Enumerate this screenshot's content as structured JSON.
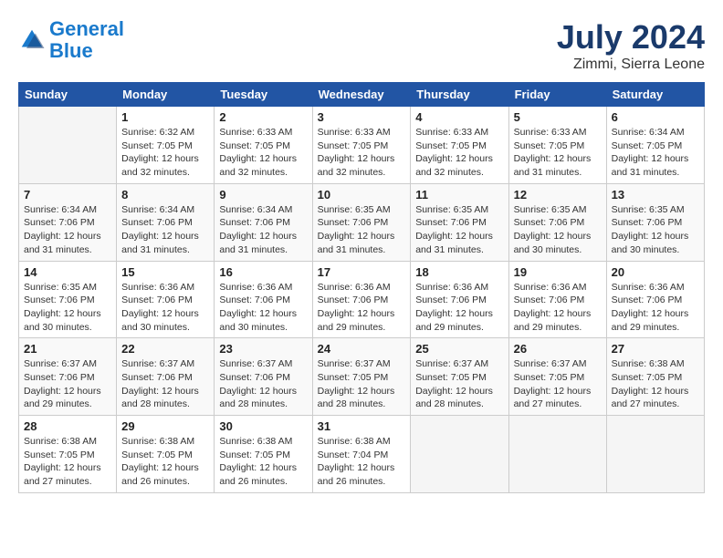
{
  "header": {
    "logo_line1": "General",
    "logo_line2": "Blue",
    "month_title": "July 2024",
    "subtitle": "Zimmi, Sierra Leone"
  },
  "weekdays": [
    "Sunday",
    "Monday",
    "Tuesday",
    "Wednesday",
    "Thursday",
    "Friday",
    "Saturday"
  ],
  "weeks": [
    [
      {
        "day": "",
        "info": ""
      },
      {
        "day": "1",
        "info": "Sunrise: 6:32 AM\nSunset: 7:05 PM\nDaylight: 12 hours\nand 32 minutes."
      },
      {
        "day": "2",
        "info": "Sunrise: 6:33 AM\nSunset: 7:05 PM\nDaylight: 12 hours\nand 32 minutes."
      },
      {
        "day": "3",
        "info": "Sunrise: 6:33 AM\nSunset: 7:05 PM\nDaylight: 12 hours\nand 32 minutes."
      },
      {
        "day": "4",
        "info": "Sunrise: 6:33 AM\nSunset: 7:05 PM\nDaylight: 12 hours\nand 32 minutes."
      },
      {
        "day": "5",
        "info": "Sunrise: 6:33 AM\nSunset: 7:05 PM\nDaylight: 12 hours\nand 31 minutes."
      },
      {
        "day": "6",
        "info": "Sunrise: 6:34 AM\nSunset: 7:05 PM\nDaylight: 12 hours\nand 31 minutes."
      }
    ],
    [
      {
        "day": "7",
        "info": "Sunrise: 6:34 AM\nSunset: 7:06 PM\nDaylight: 12 hours\nand 31 minutes."
      },
      {
        "day": "8",
        "info": "Sunrise: 6:34 AM\nSunset: 7:06 PM\nDaylight: 12 hours\nand 31 minutes."
      },
      {
        "day": "9",
        "info": "Sunrise: 6:34 AM\nSunset: 7:06 PM\nDaylight: 12 hours\nand 31 minutes."
      },
      {
        "day": "10",
        "info": "Sunrise: 6:35 AM\nSunset: 7:06 PM\nDaylight: 12 hours\nand 31 minutes."
      },
      {
        "day": "11",
        "info": "Sunrise: 6:35 AM\nSunset: 7:06 PM\nDaylight: 12 hours\nand 31 minutes."
      },
      {
        "day": "12",
        "info": "Sunrise: 6:35 AM\nSunset: 7:06 PM\nDaylight: 12 hours\nand 30 minutes."
      },
      {
        "day": "13",
        "info": "Sunrise: 6:35 AM\nSunset: 7:06 PM\nDaylight: 12 hours\nand 30 minutes."
      }
    ],
    [
      {
        "day": "14",
        "info": "Sunrise: 6:35 AM\nSunset: 7:06 PM\nDaylight: 12 hours\nand 30 minutes."
      },
      {
        "day": "15",
        "info": "Sunrise: 6:36 AM\nSunset: 7:06 PM\nDaylight: 12 hours\nand 30 minutes."
      },
      {
        "day": "16",
        "info": "Sunrise: 6:36 AM\nSunset: 7:06 PM\nDaylight: 12 hours\nand 30 minutes."
      },
      {
        "day": "17",
        "info": "Sunrise: 6:36 AM\nSunset: 7:06 PM\nDaylight: 12 hours\nand 29 minutes."
      },
      {
        "day": "18",
        "info": "Sunrise: 6:36 AM\nSunset: 7:06 PM\nDaylight: 12 hours\nand 29 minutes."
      },
      {
        "day": "19",
        "info": "Sunrise: 6:36 AM\nSunset: 7:06 PM\nDaylight: 12 hours\nand 29 minutes."
      },
      {
        "day": "20",
        "info": "Sunrise: 6:36 AM\nSunset: 7:06 PM\nDaylight: 12 hours\nand 29 minutes."
      }
    ],
    [
      {
        "day": "21",
        "info": "Sunrise: 6:37 AM\nSunset: 7:06 PM\nDaylight: 12 hours\nand 29 minutes."
      },
      {
        "day": "22",
        "info": "Sunrise: 6:37 AM\nSunset: 7:06 PM\nDaylight: 12 hours\nand 28 minutes."
      },
      {
        "day": "23",
        "info": "Sunrise: 6:37 AM\nSunset: 7:06 PM\nDaylight: 12 hours\nand 28 minutes."
      },
      {
        "day": "24",
        "info": "Sunrise: 6:37 AM\nSunset: 7:05 PM\nDaylight: 12 hours\nand 28 minutes."
      },
      {
        "day": "25",
        "info": "Sunrise: 6:37 AM\nSunset: 7:05 PM\nDaylight: 12 hours\nand 28 minutes."
      },
      {
        "day": "26",
        "info": "Sunrise: 6:37 AM\nSunset: 7:05 PM\nDaylight: 12 hours\nand 27 minutes."
      },
      {
        "day": "27",
        "info": "Sunrise: 6:38 AM\nSunset: 7:05 PM\nDaylight: 12 hours\nand 27 minutes."
      }
    ],
    [
      {
        "day": "28",
        "info": "Sunrise: 6:38 AM\nSunset: 7:05 PM\nDaylight: 12 hours\nand 27 minutes."
      },
      {
        "day": "29",
        "info": "Sunrise: 6:38 AM\nSunset: 7:05 PM\nDaylight: 12 hours\nand 26 minutes."
      },
      {
        "day": "30",
        "info": "Sunrise: 6:38 AM\nSunset: 7:05 PM\nDaylight: 12 hours\nand 26 minutes."
      },
      {
        "day": "31",
        "info": "Sunrise: 6:38 AM\nSunset: 7:04 PM\nDaylight: 12 hours\nand 26 minutes."
      },
      {
        "day": "",
        "info": ""
      },
      {
        "day": "",
        "info": ""
      },
      {
        "day": "",
        "info": ""
      }
    ]
  ]
}
